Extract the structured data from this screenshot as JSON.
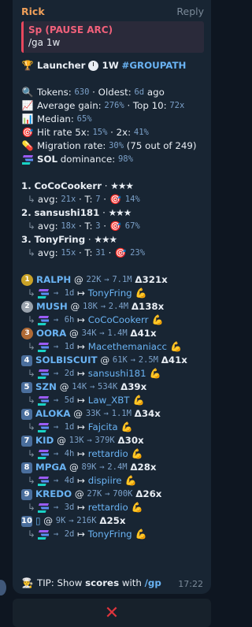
{
  "message": {
    "sender": "Rick",
    "reply_label": "Reply",
    "time": "17:22",
    "quote": {
      "name": "Sp (PAUSE ARC)",
      "text": "/ga 1w"
    },
    "title": {
      "prefix": "Launcher",
      "period": "1W",
      "tag": "#GROUPATH"
    },
    "stats": {
      "tokens_label": "Tokens:",
      "tokens": "630",
      "oldest_label": "· Oldest:",
      "oldest": "6d",
      "oldest_suffix": "ago",
      "avg_gain_label": "Average gain:",
      "avg_gain": "276%",
      "top10_label": "· Top 10:",
      "top10": "72x",
      "median_label": "Median:",
      "median": "65%",
      "hit_rate_label": "Hit rate 5x:",
      "hit_rate": "15%",
      "two_x_label": "· 2x:",
      "two_x": "41%",
      "migration_label": "Migration rate:",
      "migration": "30%",
      "migration_detail": "(75 out of 249)",
      "dominance_label": "SOL",
      "dominance_text": "dominance:",
      "dominance": "98%"
    },
    "leaders": [
      {
        "rank": "1.",
        "name": "CoCoCookerr",
        "stars": "★★★",
        "avg": "21x",
        "t": "7",
        "hit": "14%"
      },
      {
        "rank": "2.",
        "name": "sansushi181",
        "stars": "★★★",
        "avg": "18x",
        "t": "3",
        "hit": "67%"
      },
      {
        "rank": "3.",
        "name": "TonyFring",
        "stars": "★★★",
        "avg": "15x",
        "t": "31",
        "hit": "23%"
      }
    ],
    "labels": {
      "avg": "avg:",
      "t": "T:",
      "dot": "·",
      "at": "@",
      "delta": "Δ",
      "arrow_r": "→",
      "mapsto": "↦"
    },
    "tokens": [
      {
        "badge": "1",
        "name": "RALPH",
        "from": "22K",
        "to": "7.1M",
        "mult": "321x",
        "age": "1d",
        "caller": "TonyFring"
      },
      {
        "badge": "2",
        "name": "MUSH",
        "from": "18K",
        "to": "2.4M",
        "mult": "138x",
        "age": "6h",
        "caller": "CoCoCookerr"
      },
      {
        "badge": "3",
        "name": "OORA",
        "from": "34K",
        "to": "1.4M",
        "mult": "41x",
        "age": "1d",
        "caller": "Macethemaniacc"
      },
      {
        "badge": "4",
        "name": "SOLBISCUIT",
        "from": "61K",
        "to": "2.5M",
        "mult": "41x",
        "age": "2d",
        "caller": "sansushi181"
      },
      {
        "badge": "5",
        "name": "SZN",
        "from": "14K",
        "to": "534K",
        "mult": "39x",
        "age": "5d",
        "caller": "Law_XBT"
      },
      {
        "badge": "6",
        "name": "ALOKA",
        "from": "33K",
        "to": "1.1M",
        "mult": "34x",
        "age": "1d",
        "caller": "Fajcita"
      },
      {
        "badge": "7",
        "name": "KID",
        "from": "13K",
        "to": "379K",
        "mult": "30x",
        "age": "4h",
        "caller": "rettardio"
      },
      {
        "badge": "8",
        "name": "MPGA",
        "from": "89K",
        "to": "2.4M",
        "mult": "28x",
        "age": "4d",
        "caller": "dispiire"
      },
      {
        "badge": "9",
        "name": "KREDO",
        "from": "27K",
        "to": "700K",
        "mult": "26x",
        "age": "3d",
        "caller": "rettardio"
      },
      {
        "badge": "10",
        "name": "▯",
        "from": "9K",
        "to": "216K",
        "mult": "25x",
        "age": "2d",
        "caller": "TonyFring"
      }
    ],
    "tip": {
      "label": "TIP:",
      "text1": "Show",
      "bold": "scores",
      "text2": "with",
      "cmd": "/gp"
    }
  },
  "colors": {
    "bg": "#0e1621",
    "bubble": "#182533",
    "accent": "#6ab3f3",
    "sender": "#f0a05a",
    "close": "#e0343c"
  },
  "bottom": {
    "close_glyph": "✕"
  }
}
